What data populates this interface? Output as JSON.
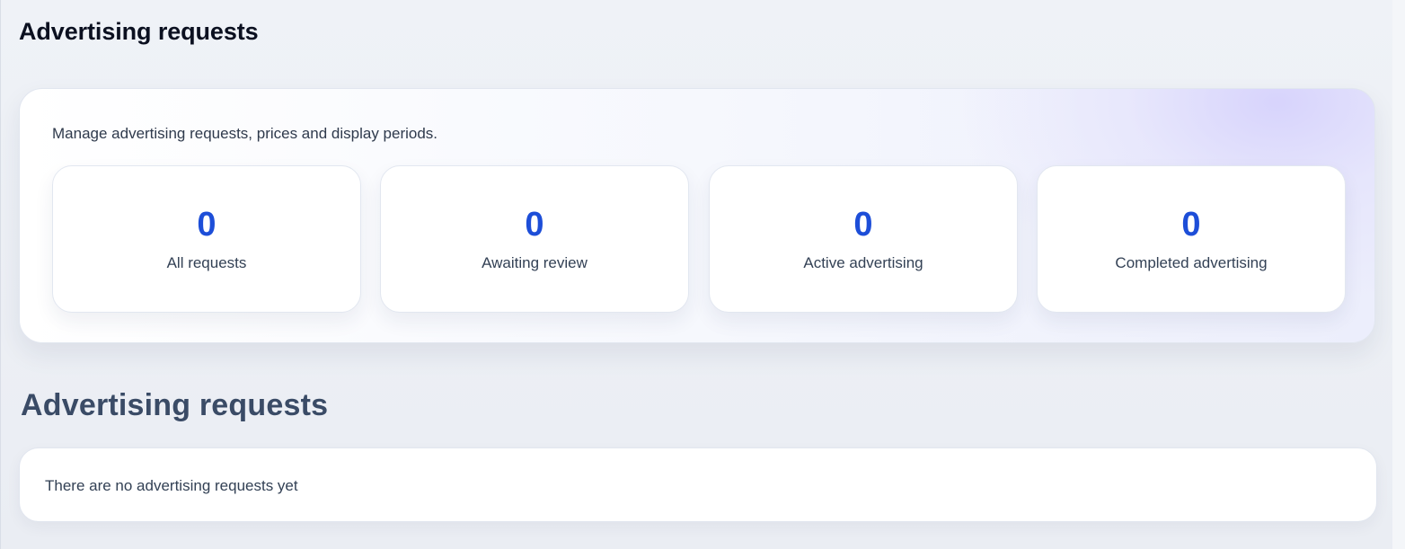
{
  "page": {
    "title": "Advertising requests"
  },
  "summary": {
    "description": "Manage advertising requests, prices and display periods.",
    "stats": [
      {
        "value": "0",
        "label": "All requests"
      },
      {
        "value": "0",
        "label": "Awaiting review"
      },
      {
        "value": "0",
        "label": "Active advertising"
      },
      {
        "value": "0",
        "label": "Completed advertising"
      }
    ]
  },
  "requests_section": {
    "heading": "Advertising requests",
    "empty_message": "There are no advertising requests yet"
  },
  "colors": {
    "accent": "#1d4ed8",
    "background": "#eef1f6",
    "card": "#ffffff"
  }
}
